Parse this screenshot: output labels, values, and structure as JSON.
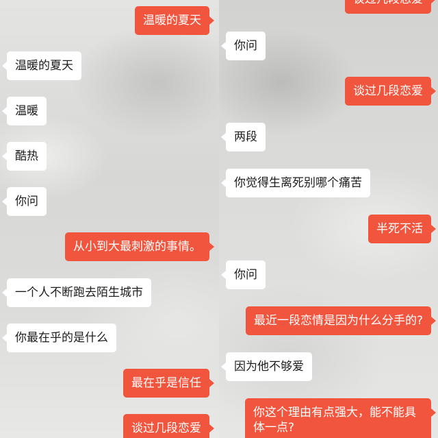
{
  "theme": {
    "incoming_bg": "#ffffff",
    "outgoing_bg": "#f2553d"
  },
  "left_panel": {
    "messages": [
      {
        "side": "out",
        "text": "温暖的夏天"
      },
      {
        "side": "in",
        "text": "温暖的夏天"
      },
      {
        "side": "in",
        "text": "温暖"
      },
      {
        "side": "in",
        "text": "酷热"
      },
      {
        "side": "in",
        "text": "你问"
      },
      {
        "side": "out",
        "text": "从小到大最刺激的事情。"
      },
      {
        "side": "in",
        "text": "一个人不断跑去陌生城市"
      },
      {
        "side": "in",
        "text": "你最在乎的是什么"
      },
      {
        "side": "out",
        "text": "最在乎是信任"
      },
      {
        "side": "out",
        "text": "谈过几段恋爱"
      }
    ]
  },
  "right_panel": {
    "messages": [
      {
        "side": "out",
        "text": "谈过几段恋爱"
      },
      {
        "side": "in",
        "text": "你问"
      },
      {
        "side": "out",
        "text": "谈过几段恋爱"
      },
      {
        "side": "in",
        "text": "两段"
      },
      {
        "side": "in",
        "text": "你觉得生离死别哪个痛苦"
      },
      {
        "side": "out",
        "text": "半死不活"
      },
      {
        "side": "in",
        "text": "你问"
      },
      {
        "side": "out",
        "text": "最近一段恋情是因为什么分手的?"
      },
      {
        "side": "in",
        "text": "因为他不够爱"
      },
      {
        "side": "out",
        "text": "你这个理由有点强大，能不能具体一点?"
      }
    ]
  }
}
